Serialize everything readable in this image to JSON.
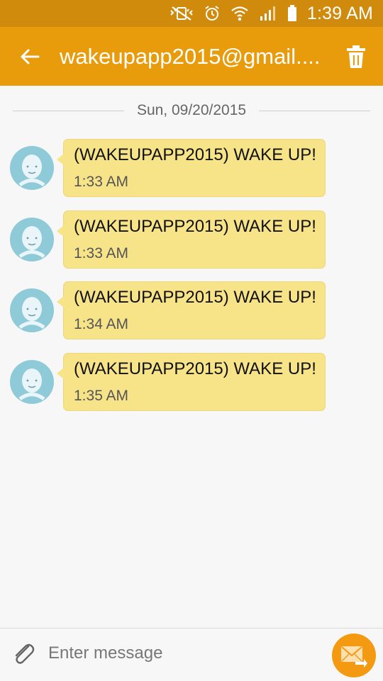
{
  "status_bar": {
    "time": "1:39 AM",
    "icons": [
      "vibrate-mute-icon",
      "alarm-icon",
      "wifi-icon",
      "signal-icon",
      "battery-icon"
    ]
  },
  "app_bar": {
    "title": "wakeupapp2015@gmail....",
    "back_icon": "back-arrow-icon",
    "delete_icon": "trash-icon",
    "color": "#e89b0b"
  },
  "conversation": {
    "date": "Sun, 09/20/2015",
    "messages": [
      {
        "text": "(WAKEUPAPP2015) WAKE UP!",
        "time": "1:33 AM"
      },
      {
        "text": "(WAKEUPAPP2015) WAKE UP!",
        "time": "1:33 AM"
      },
      {
        "text": "(WAKEUPAPP2015) WAKE UP!",
        "time": "1:34 AM"
      },
      {
        "text": "(WAKEUPAPP2015) WAKE UP!",
        "time": "1:35 AM"
      }
    ],
    "bubble_color": "#f7e489",
    "avatar_color": "#8fcad8"
  },
  "composer": {
    "placeholder": "Enter message",
    "attach_icon": "paperclip-icon",
    "send_icon": "send-message-icon",
    "send_color": "#f39a12"
  }
}
